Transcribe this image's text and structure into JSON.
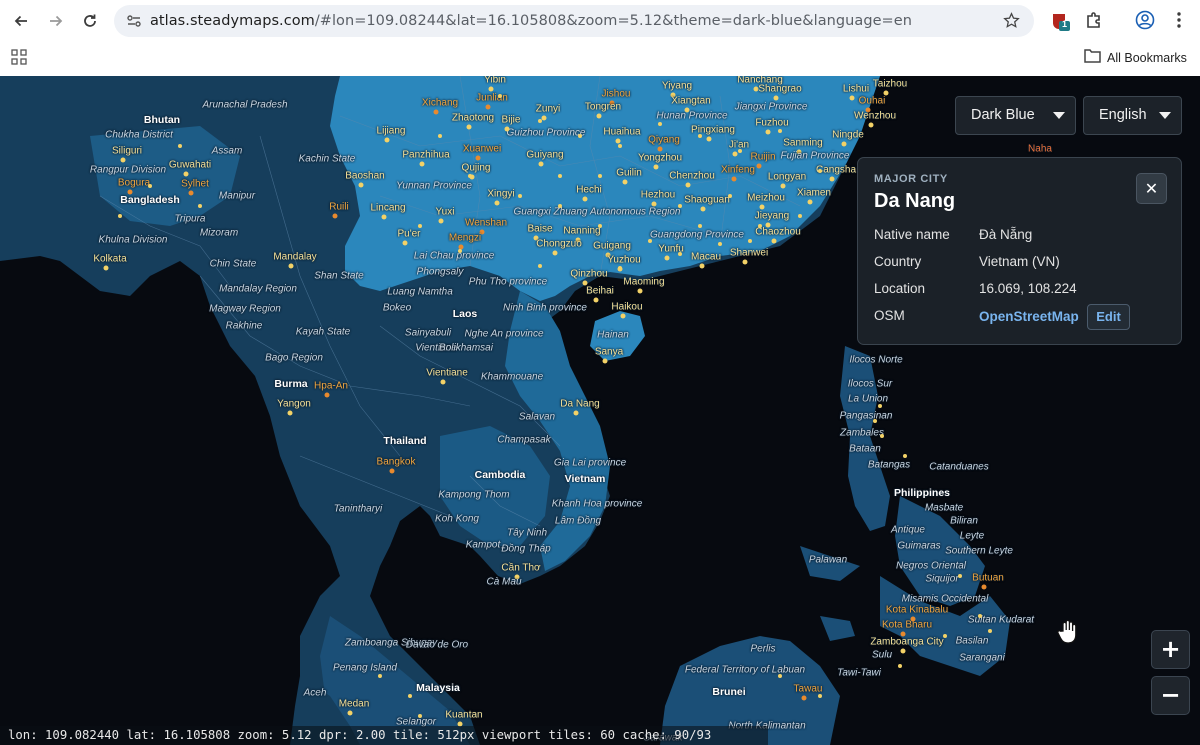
{
  "browser": {
    "url_path": "/#lon=109.08244&lat=16.105808&zoom=5.12&theme=dark-blue&language=en",
    "url_host": "atlas.steadymaps.com",
    "bookmarks_label": "All Bookmarks",
    "extension_badge": "1",
    "icons": [
      "back-icon",
      "forward-icon",
      "reload-icon",
      "site-settings-icon",
      "star-icon",
      "extension-icon",
      "puzzle-icon",
      "profile-icon",
      "menu-icon",
      "apps-icon",
      "folder-icon"
    ]
  },
  "controls": {
    "theme_select": "Dark Blue",
    "language_select": "English",
    "zoom_in": "+",
    "zoom_out": "−"
  },
  "popup": {
    "eyebrow": "MAJOR CITY",
    "title": "Da Nang",
    "close": "✕",
    "rows": [
      {
        "key": "Native name",
        "value": "Đà Nẵng"
      },
      {
        "key": "Country",
        "value": "Vietnam (VN)"
      },
      {
        "key": "Location",
        "value": "16.069, 108.224"
      },
      {
        "key": "OSM",
        "value": ""
      }
    ],
    "osm_link": "OpenStreetMap",
    "edit_button": "Edit"
  },
  "status_bar": "lon: 109.082440 lat: 16.105808 zoom: 5.12 dpr: 2.00 tile: 512px viewport tiles: 60 cache: 90/93",
  "map": {
    "theme_colors": {
      "land": "#1b4f77",
      "land_highlight": "#2b87bc",
      "water": "#070a10",
      "city": "#f3d267"
    },
    "labels": [
      {
        "t": "Yibin",
        "c": "city"
      },
      {
        "t": "Jishou",
        "c": "orange"
      },
      {
        "t": "Yiyang",
        "c": "city"
      },
      {
        "t": "Nanchang",
        "c": "city"
      },
      {
        "t": "Taizhou",
        "c": "city"
      },
      {
        "t": "Junlian",
        "c": "orange"
      },
      {
        "t": "Guizhou Province",
        "c": "region"
      },
      {
        "t": "Tongren",
        "c": "city"
      },
      {
        "t": "Xiangtan",
        "c": "city"
      },
      {
        "t": "Shangrao",
        "c": "city"
      },
      {
        "t": "Lishui",
        "c": "city"
      },
      {
        "t": "Ouhai",
        "c": "orange"
      },
      {
        "t": "Arunachal Pradesh",
        "c": "region"
      },
      {
        "t": "Xichang",
        "c": "orange"
      },
      {
        "t": "Zunyi",
        "c": "city"
      },
      {
        "t": "Jiangxi Province",
        "c": "region"
      },
      {
        "t": "Wenzhou",
        "c": "city"
      },
      {
        "t": "Bhutan",
        "c": "big"
      },
      {
        "t": "Zhaotong",
        "c": "city"
      },
      {
        "t": "Bijie",
        "c": "city"
      },
      {
        "t": "Hunan Province",
        "c": "region"
      },
      {
        "t": "Fuzhou",
        "c": "city"
      },
      {
        "t": "Chukha District",
        "c": "region"
      },
      {
        "t": "Lijiang",
        "c": "city"
      },
      {
        "t": "Huaihua",
        "c": "city"
      },
      {
        "t": "Pingxiang",
        "c": "city"
      },
      {
        "t": "Ningde",
        "c": "city"
      },
      {
        "t": "Siliguri",
        "c": "city"
      },
      {
        "t": "Assam",
        "c": "region"
      },
      {
        "t": "Panzhihua",
        "c": "city"
      },
      {
        "t": "Xuanwei",
        "c": "orange"
      },
      {
        "t": "Guiyang",
        "c": "city"
      },
      {
        "t": "Qiyang",
        "c": "orange"
      },
      {
        "t": "Ji'an",
        "c": "city"
      },
      {
        "t": "Sanming",
        "c": "city"
      },
      {
        "t": "Naha",
        "c": "red"
      },
      {
        "t": "Kachin State",
        "c": "region"
      },
      {
        "t": "Guwahati",
        "c": "city"
      },
      {
        "t": "Yongzhou",
        "c": "city"
      },
      {
        "t": "Ruijin",
        "c": "orange"
      },
      {
        "t": "Fujian Province",
        "c": "region"
      },
      {
        "t": "Rangpur Division",
        "c": "region"
      },
      {
        "t": "Qujing",
        "c": "city"
      },
      {
        "t": "Guilin",
        "c": "city"
      },
      {
        "t": "Xinfeng",
        "c": "orange"
      },
      {
        "t": "Cangsha",
        "c": "city"
      },
      {
        "t": "Bogura",
        "c": "orange"
      },
      {
        "t": "Sylhet",
        "c": "orange"
      },
      {
        "t": "Baoshan",
        "c": "city"
      },
      {
        "t": "Yunnan Province",
        "c": "region"
      },
      {
        "t": "Chenzhou",
        "c": "city"
      },
      {
        "t": "Longyan",
        "c": "city"
      },
      {
        "t": "Manipur",
        "c": "region"
      },
      {
        "t": "Xingyi",
        "c": "city"
      },
      {
        "t": "Hechi",
        "c": "city"
      },
      {
        "t": "Hezhou",
        "c": "city"
      },
      {
        "t": "Xiamen",
        "c": "city"
      },
      {
        "t": "Bangladesh",
        "c": "big"
      },
      {
        "t": "Shaoguan",
        "c": "city"
      },
      {
        "t": "Meizhou",
        "c": "city"
      },
      {
        "t": "Ruili",
        "c": "orange"
      },
      {
        "t": "Lincang",
        "c": "city"
      },
      {
        "t": "Yuxi",
        "c": "city"
      },
      {
        "t": "Guangxi Zhuang Autonomous Region",
        "c": "region"
      },
      {
        "t": "Jieyang",
        "c": "city"
      },
      {
        "t": "Tripura",
        "c": "region"
      },
      {
        "t": "Wenshan",
        "c": "orange"
      },
      {
        "t": "Baise",
        "c": "city"
      },
      {
        "t": "Nanning",
        "c": "city"
      },
      {
        "t": "Guangdong Province",
        "c": "region"
      },
      {
        "t": "Chaozhou",
        "c": "city"
      },
      {
        "t": "Mizoram",
        "c": "region"
      },
      {
        "t": "Pu'er",
        "c": "city"
      },
      {
        "t": "Mengzi",
        "c": "orange"
      },
      {
        "t": "Khulna Division",
        "c": "region"
      },
      {
        "t": "Chongzuo",
        "c": "city"
      },
      {
        "t": "Guigang",
        "c": "city"
      },
      {
        "t": "Yunfu",
        "c": "city"
      },
      {
        "t": "Mandalay",
        "c": "city"
      },
      {
        "t": "Lai Chau province",
        "c": "region"
      },
      {
        "t": "Shanwei",
        "c": "city"
      },
      {
        "t": "Kolkata",
        "c": "city"
      },
      {
        "t": "Chin State",
        "c": "region"
      },
      {
        "t": "Yuzhou",
        "c": "city"
      },
      {
        "t": "Macau",
        "c": "city"
      },
      {
        "t": "Phongsaly",
        "c": "region"
      },
      {
        "t": "Qinzhou",
        "c": "city"
      },
      {
        "t": "Shan State",
        "c": "region"
      },
      {
        "t": "Maoming",
        "c": "city"
      },
      {
        "t": "Phu Tho province",
        "c": "region"
      },
      {
        "t": "Mandalay Region",
        "c": "region"
      },
      {
        "t": "Luang Namtha",
        "c": "region"
      },
      {
        "t": "Beihai",
        "c": "city"
      },
      {
        "t": "Haikou",
        "c": "city"
      },
      {
        "t": "Magway Region",
        "c": "region"
      },
      {
        "t": "Bokeo",
        "c": "region"
      },
      {
        "t": "Ninh Binh province",
        "c": "region"
      },
      {
        "t": "Laos",
        "c": "big"
      },
      {
        "t": "Rakhine",
        "c": "region"
      },
      {
        "t": "Kayah State",
        "c": "region"
      },
      {
        "t": "Sainyabuli",
        "c": "region"
      },
      {
        "t": "Nghe An province",
        "c": "region"
      },
      {
        "t": "Hainan",
        "c": "region"
      },
      {
        "t": "Vientiane",
        "c": "region"
      },
      {
        "t": "Bolikhamsai",
        "c": "region"
      },
      {
        "t": "Sanya",
        "c": "city"
      },
      {
        "t": "Bago Region",
        "c": "region"
      },
      {
        "t": "Ilocos Norte",
        "c": "region"
      },
      {
        "t": "Vientiane",
        "c": "city"
      },
      {
        "t": "Khammouane",
        "c": "region"
      },
      {
        "t": "Burma",
        "c": "big"
      },
      {
        "t": "Hpa-An",
        "c": "orange"
      },
      {
        "t": "Ilocos Sur",
        "c": "region"
      },
      {
        "t": "La Union",
        "c": "region"
      },
      {
        "t": "Yangon",
        "c": "city"
      },
      {
        "t": "Da Nang",
        "c": "city"
      },
      {
        "t": "Pangasinan",
        "c": "region"
      },
      {
        "t": "Salavan",
        "c": "region"
      },
      {
        "t": "Zambales",
        "c": "region"
      },
      {
        "t": "Thailand",
        "c": "big"
      },
      {
        "t": "Champasak",
        "c": "region"
      },
      {
        "t": "Bataan",
        "c": "region"
      },
      {
        "t": "Bangkok",
        "c": "orange"
      },
      {
        "t": "Gia Lai province",
        "c": "region"
      },
      {
        "t": "Batangas",
        "c": "region"
      },
      {
        "t": "Catanduanes",
        "c": "region"
      },
      {
        "t": "Cambodia",
        "c": "big"
      },
      {
        "t": "Vietnam",
        "c": "big"
      },
      {
        "t": "Kampong Thom",
        "c": "region"
      },
      {
        "t": "Philippines",
        "c": "big"
      },
      {
        "t": "Khanh Hoa province",
        "c": "region"
      },
      {
        "t": "Masbate",
        "c": "region"
      },
      {
        "t": "Tanintharyi",
        "c": "region"
      },
      {
        "t": "Koh Kong",
        "c": "region"
      },
      {
        "t": "Lâm Đồng",
        "c": "region"
      },
      {
        "t": "Biliran",
        "c": "region"
      },
      {
        "t": "Tây Ninh",
        "c": "region"
      },
      {
        "t": "Antique",
        "c": "region"
      },
      {
        "t": "Leyte",
        "c": "region"
      },
      {
        "t": "Kampot",
        "c": "region"
      },
      {
        "t": "Đồng Tháp",
        "c": "region"
      },
      {
        "t": "Guimaras",
        "c": "region"
      },
      {
        "t": "Southern Leyte",
        "c": "region"
      },
      {
        "t": "Palawan",
        "c": "region"
      },
      {
        "t": "Cần Thơ",
        "c": "city"
      },
      {
        "t": "Negros Oriental",
        "c": "region"
      },
      {
        "t": "Cà Mau",
        "c": "region"
      },
      {
        "t": "Siquijor",
        "c": "region"
      },
      {
        "t": "Butuan",
        "c": "orange"
      },
      {
        "t": "Misamis Occidental",
        "c": "region"
      },
      {
        "t": "Zamboanga Sibugay",
        "c": "region"
      },
      {
        "t": "Davao de Oro",
        "c": "region"
      },
      {
        "t": "Perlis",
        "c": "region"
      },
      {
        "t": "Kota Bharu",
        "c": "orange"
      },
      {
        "t": "Kota Kinabalu",
        "c": "orange"
      },
      {
        "t": "Zamboanga City",
        "c": "city"
      },
      {
        "t": "Basilan",
        "c": "region"
      },
      {
        "t": "Sultan Kudarat",
        "c": "region"
      },
      {
        "t": "Sulu",
        "c": "region"
      },
      {
        "t": "Sarangani",
        "c": "region"
      },
      {
        "t": "Penang Island",
        "c": "region"
      },
      {
        "t": "Federal Territory of Labuan",
        "c": "region"
      },
      {
        "t": "Tawi-Tawi",
        "c": "region"
      },
      {
        "t": "Malaysia",
        "c": "big"
      },
      {
        "t": "Tawau",
        "c": "orange"
      },
      {
        "t": "Aceh",
        "c": "region"
      },
      {
        "t": "Brunei",
        "c": "big"
      },
      {
        "t": "Medan",
        "c": "city"
      },
      {
        "t": "Kuantan",
        "c": "city"
      },
      {
        "t": "Selangor",
        "c": "region"
      },
      {
        "t": "North Kalimantan",
        "c": "region"
      },
      {
        "t": "Sarawak",
        "c": "region"
      }
    ]
  }
}
